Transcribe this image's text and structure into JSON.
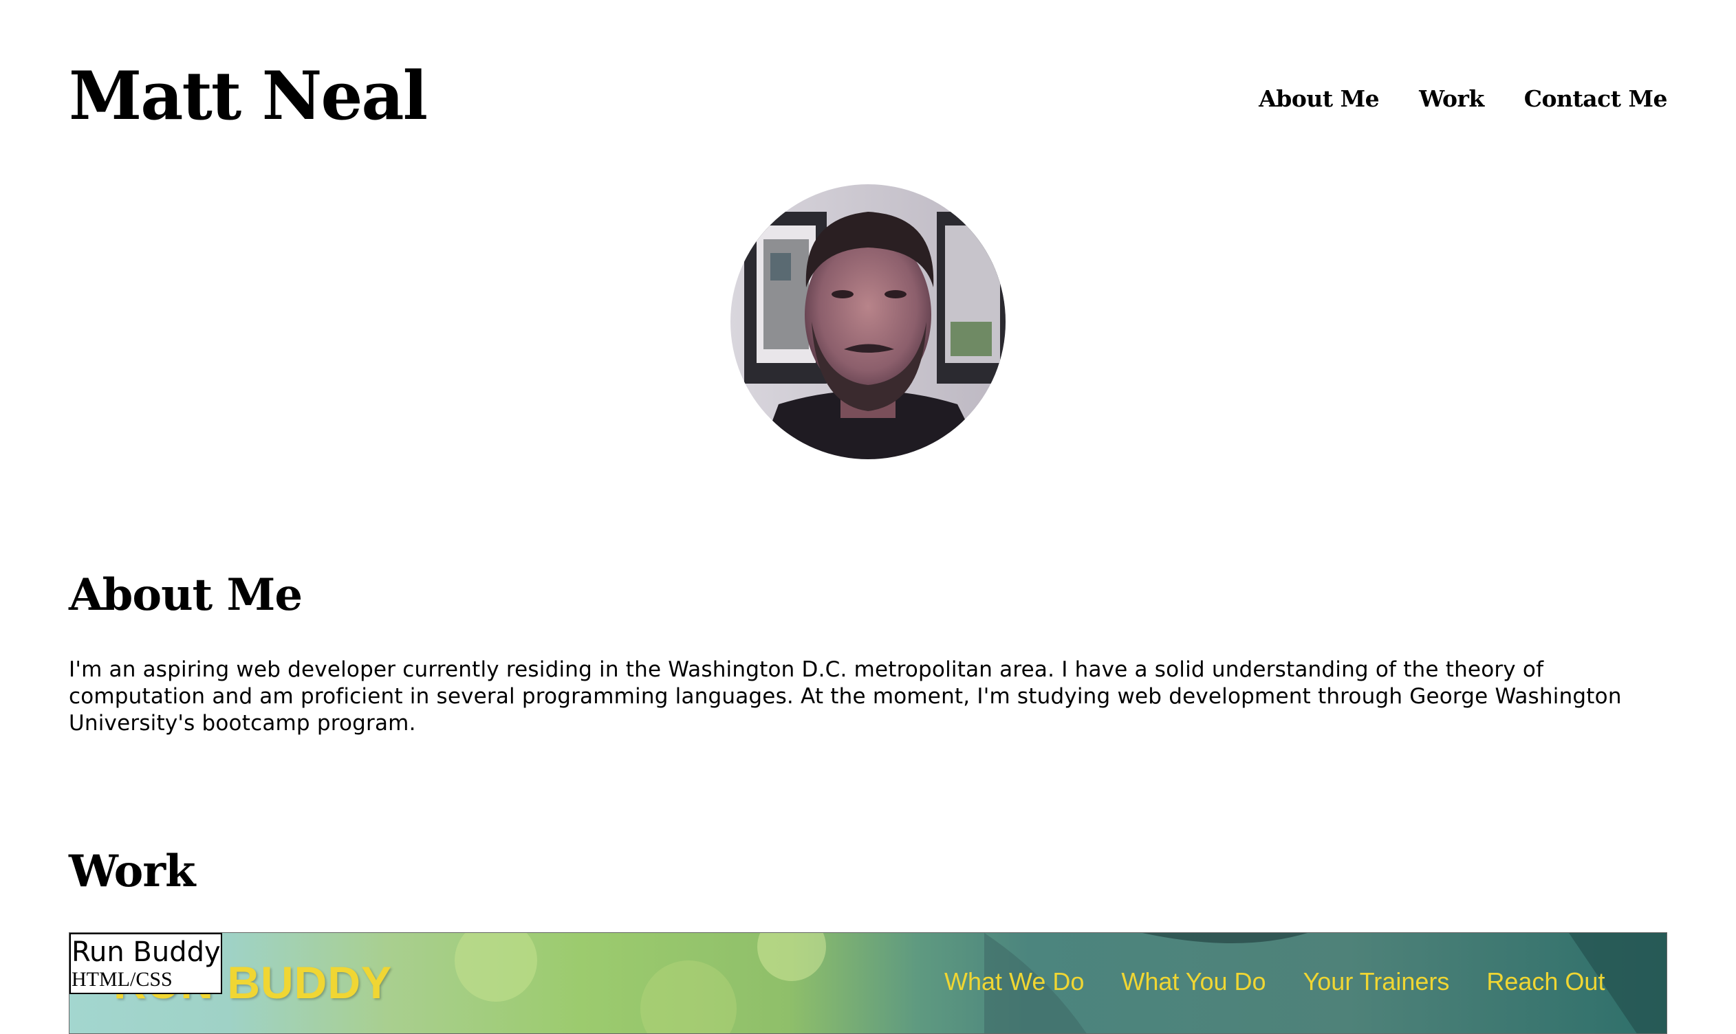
{
  "header": {
    "title": "Matt Neal",
    "nav": [
      "About Me",
      "Work",
      "Contact Me"
    ]
  },
  "avatar": {
    "icon": "profile-photo"
  },
  "about": {
    "heading": "About Me",
    "text": "I'm an aspiring web developer currently residing in the Washington D.C. metropolitan area. I have a solid understanding of the theory of computation and am proficient in several programming languages. At the moment, I'm studying web development through George Washington University's bootcamp program."
  },
  "work": {
    "heading": "Work",
    "projects": [
      {
        "title": "Run Buddy",
        "tech": "HTML/CSS",
        "preview_logo": "RUN BUDDY",
        "preview_nav": [
          "What We Do",
          "What You Do",
          "Your Trainers",
          "Reach Out"
        ],
        "accent_color": "#f0d633"
      }
    ]
  }
}
